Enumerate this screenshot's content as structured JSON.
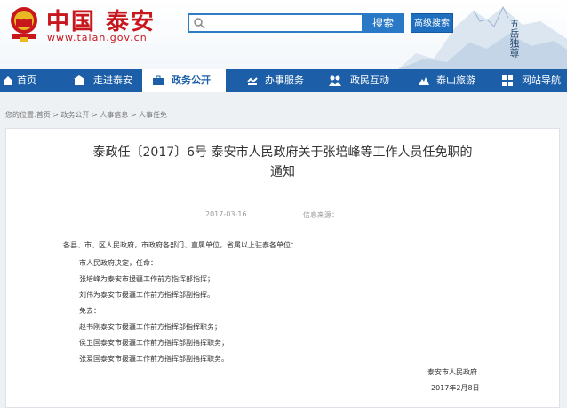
{
  "header": {
    "site_title": "中国 泰安",
    "site_url": "www.taian.gov.cn",
    "search_button": "搜索",
    "advanced_search_button": "高级搜索",
    "seal_text": "五岳独尊",
    "search_placeholder": ""
  },
  "nav": {
    "items": [
      {
        "label": "首页",
        "icon": "home-icon"
      },
      {
        "label": "走进泰安",
        "icon": "building-icon"
      },
      {
        "label": "政务公开",
        "icon": "briefcase-icon",
        "active": true
      },
      {
        "label": "办事服务",
        "icon": "service-icon"
      },
      {
        "label": "政民互动",
        "icon": "people-icon"
      },
      {
        "label": "泰山旅游",
        "icon": "mountain-icon"
      },
      {
        "label": "网站导航",
        "icon": "grid-icon"
      }
    ]
  },
  "breadcrumb": "您的位置:首页 > 政务公开 > 人事信息 > 人事任免",
  "article": {
    "title_line1": "泰政任〔2017〕6号 泰安市人民政府关于张培峰等工作人员任免职的",
    "title_line2": "通知",
    "date": "2017-03-16",
    "source": "信息来源：",
    "body": [
      "各县、市、区人民政府，市政府各部门、直属单位，省属以上驻泰各单位：",
      "市人民政府决定，任命：",
      "张培峰为泰安市援疆工作前方指挥部指挥；",
      "刘伟为泰安市援疆工作前方指挥部副指挥。",
      "免去：",
      "赵书刚泰安市援疆工作前方指挥部指挥职务；",
      "侯卫国泰安市援疆工作前方指挥部副指挥职务；",
      "张爱国泰安市援疆工作前方指挥部副指挥职务。"
    ],
    "signature": "泰安市人民政府",
    "signature_date": "2017年2月8日"
  },
  "colors": {
    "brand_red": "#c8161d",
    "nav_blue": "#1c5fa8",
    "button_blue": "#2a79c6"
  }
}
